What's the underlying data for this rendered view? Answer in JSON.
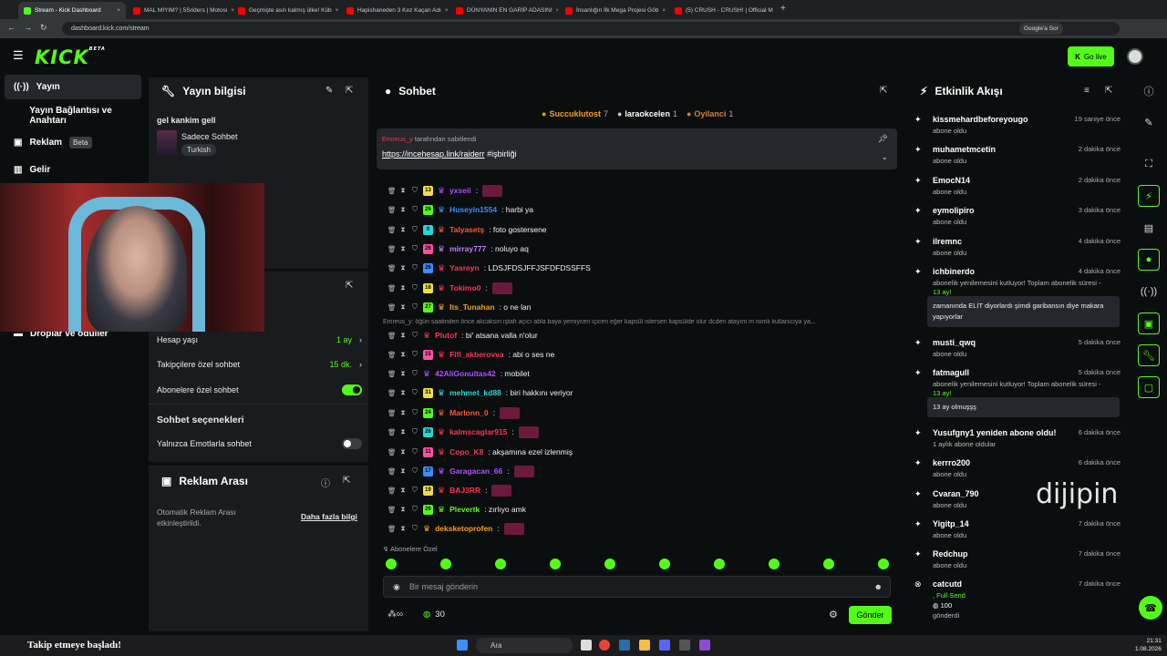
{
  "browser": {
    "tabs": [
      {
        "title": "Stream - Kick Dashboard",
        "active": true,
        "color": "#53fc18"
      },
      {
        "title": "MAL MIYIM? | 5Sriders | Motosi",
        "color": "#ff0000"
      },
      {
        "title": "Geçmişte asılı kalmış ülke! Küb",
        "color": "#ff0000"
      },
      {
        "title": "Hapishaneden 3 Kez Kaçan Adı",
        "color": "#ff0000"
      },
      {
        "title": "DÜNYANIN EN GARİP ADASINI",
        "color": "#ff0000"
      },
      {
        "title": "İnsanlığın İlk Mega Projesi Göb",
        "color": "#ff0000"
      },
      {
        "title": "(5) CRUSH - CRUSH! | Official M",
        "color": "#ff0000"
      }
    ],
    "url": "dashboard.kick.com/stream",
    "google_label": "Google'a Sor"
  },
  "header": {
    "logo": "KICK",
    "logo_sup": "BETA",
    "go_live": "Go live"
  },
  "leftnav": {
    "items": [
      {
        "label": "Yayın",
        "selected": true
      },
      {
        "label": "Yayın Bağlantısı ve Anahtarı"
      },
      {
        "label": "Reklam",
        "badge": "Beta"
      },
      {
        "label": "Gelir"
      },
      {
        "label": "Droplar ve ödüller"
      }
    ]
  },
  "stream_info": {
    "title": "Yayın bilgisi",
    "stream_title": "gel kankim gell",
    "category": "Sadece Sohbet",
    "tag": "Turkish"
  },
  "chat_settings": {
    "rows": [
      {
        "label": "Hesap yaşı",
        "value": "1 ay"
      },
      {
        "label": "Takipçilere özel sohbet",
        "value": "15 dk."
      },
      {
        "label": "Abonelere özel sohbet",
        "toggle": "on"
      }
    ],
    "section": "Sohbet seçenekleri",
    "emote_only": "Yalnızca Emotlarla sohbet"
  },
  "ad_break": {
    "title": "Reklam Arası",
    "desc": "Otomatik Reklam Arası etkinleştirildi.",
    "link": "Daha fazla bilgi"
  },
  "chat": {
    "title": "Sohbet",
    "top_gifters": [
      {
        "name": "Succuklutost",
        "count": "7",
        "color": "#f0a020"
      },
      {
        "name": "laraokcelen",
        "count": "1",
        "color": "#cccccc"
      },
      {
        "name": "Oyilanci",
        "count": "1",
        "color": "#d08040"
      }
    ],
    "pinned_by": "tarafından sabitlendi",
    "pinned_link": "https://incehesap.link/raiderr",
    "pinned_tag": "#işbirliği",
    "messages": [
      {
        "badge": "13",
        "user": "yxseii",
        "color": "#b34dff",
        "text": ":",
        "emote": true
      },
      {
        "badge": "26",
        "user": "Huseyin1554",
        "color": "#3a8eff",
        "text": ": harbi ya"
      },
      {
        "badge": "0",
        "user": "Talyasetş",
        "color": "#ff5533",
        "text": ": foto gostersene"
      },
      {
        "badge": "26",
        "user": "mirray777",
        "color": "#c27dff",
        "text": ": noluyo aq"
      },
      {
        "badge": "26",
        "user": "Yasreyn",
        "color": "#ff3355",
        "text": ": LDSJFDSJFFJSFDFDSSFFS"
      },
      {
        "badge": "16",
        "user": "Tokimo0",
        "color": "#ff3355",
        "text": ":",
        "emote": true
      },
      {
        "badge": "27",
        "user": "Its_Tunahan",
        "color": "#f0a020",
        "text": ": o ne lan"
      },
      {
        "badge": "",
        "user": "Plutof",
        "color": "#ff3355",
        "text": ": bi' atsana valla n'olur"
      },
      {
        "badge": "15",
        "user": "Fifi_akberovva",
        "color": "#ff3355",
        "text": ": abi o ses ne"
      },
      {
        "badge": "",
        "user": "42AliGonultas42",
        "color": "#b34dff",
        "text": ": mobilet"
      },
      {
        "badge": "31",
        "user": "mehmet_kd88",
        "color": "#29d6d6",
        "text": ": biri hakkını veriyor"
      },
      {
        "badge": "24",
        "user": "Marlonn_0",
        "color": "#ff5533",
        "text": ":",
        "emote": true
      },
      {
        "badge": "26",
        "user": "kalmscaglar915",
        "color": "#ff3355",
        "text": ":",
        "emote": true
      },
      {
        "badge": "11",
        "user": "Copo_K8",
        "color": "#ff3355",
        "text": ": akşamına ezel izlenmiş"
      },
      {
        "badge": "17",
        "user": "Garagacan_66",
        "color": "#b34dff",
        "text": ":",
        "emote": true
      },
      {
        "badge": "19",
        "user": "BAJ3RR",
        "color": "#ff3355",
        "text": ":",
        "emote": true
      },
      {
        "badge": "26",
        "user": "Plevertk",
        "color": "#53fc18",
        "text": ": zırlıyo amk"
      },
      {
        "badge": "",
        "user": "deksketoprofen",
        "color": "#f0a020",
        "text": ":",
        "emote": true
      }
    ],
    "reply_line": "Emreus_y: öğün saatinden önce akcaksın iştah açıcı abla baya yemiycen içicen eğer kapsül istersen kapsülde olur dcden atayım m isimli kullanıcıya ya...",
    "subs_only": "Abonelere Özel",
    "placeholder": "Bir mesaj gönderin",
    "points": "30",
    "send": "Gönder"
  },
  "activity": {
    "title": "Etkinlik Akışı",
    "items": [
      {
        "name": "kissmehardbeforeyougo",
        "time": "19 saniye önce",
        "sub": "abone oldu"
      },
      {
        "name": "muhametmcetin",
        "time": "2 dakika önce",
        "sub": "abone oldu"
      },
      {
        "name": "EmocN14",
        "time": "2 dakika önce",
        "sub": "abone oldu"
      },
      {
        "name": "eymolipiro",
        "time": "3 dakika önce",
        "sub": "abone oldu"
      },
      {
        "name": "ilremnc",
        "time": "4 dakika önce",
        "sub": "abone oldu"
      },
      {
        "name": "ichbinerdo",
        "time": "4 dakika önce",
        "sub": "abonelik yenilemesini kutluyor! Toplam abonelik süresi -",
        "months": "13 ay!",
        "quote": "zamanında ELİT diyorlardı şimdi garibansın diye makara yapıyorlar"
      },
      {
        "name": "musti_qwq",
        "time": "5 dakika önce",
        "sub": "abone oldu"
      },
      {
        "name": "fatmagull",
        "time": "5 dakika önce",
        "sub": "abonelik yenilemesini kutluyor! Toplam abonelik süresi -",
        "months": "13 ay!",
        "quote": "13 ay olmuşşş"
      },
      {
        "name": "Yusufgny1 yeniden abone oldu!",
        "time": "6 dakika önce",
        "sub": "1 aylık abone oldular"
      },
      {
        "name": "kerrro200",
        "time": "6 dakika önce",
        "sub": "abone oldu"
      },
      {
        "name": "Cvaran_790",
        "time": "",
        "sub": "abone oldu"
      },
      {
        "name": "Yigitp_14",
        "time": "7 dakika önce",
        "sub": "abone oldu"
      },
      {
        "name": "Redchup",
        "time": "7 dakika önce",
        "sub": "abone oldu"
      },
      {
        "name": "catcutd",
        "time": "7 dakika önce",
        "sub": ", Full Send",
        "gift": "100",
        "gift_sub": "gönderdi"
      }
    ]
  },
  "overlay": {
    "watermark": "dijipin",
    "toast": "Takip etmeye başladı!"
  },
  "taskbar": {
    "search": "Ara",
    "time": "21:31",
    "date": "1.08.2026"
  }
}
